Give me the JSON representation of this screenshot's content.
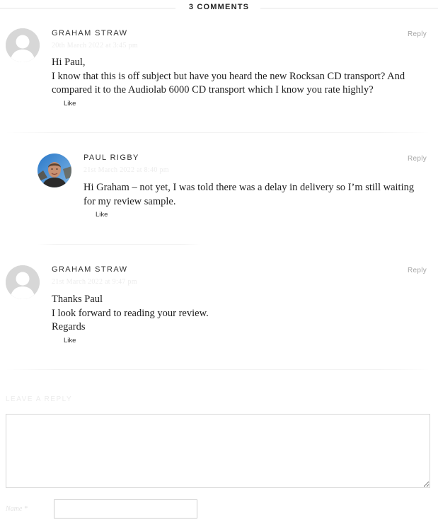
{
  "comments_header": {
    "title": "3 COMMENTS"
  },
  "comments": [
    {
      "author": "GRAHAM STRAW",
      "date": "20th March 2022 at 3:45 pm",
      "reply": "Reply",
      "paragraphs": [
        "Hi Paul,",
        "I know that this is off subject but have you heard the new Rocksan CD transport? And compared it to the Audiolab 6000 CD transport which I know you rate highly?"
      ],
      "like": "Like"
    },
    {
      "author": "PAUL RIGBY",
      "date": "21st March 2022 at 8:40 pm",
      "reply": "Reply",
      "paragraphs": [
        "Hi Graham – not yet, I was told there was a delay in delivery so I’m still waiting for my review sample."
      ],
      "like": "Like"
    },
    {
      "author": "GRAHAM STRAW",
      "date": "21st March 2022 at 9:47 pm",
      "reply": "Reply",
      "paragraphs": [
        "Thanks Paul",
        "I look forward to reading your review.",
        "Regards"
      ],
      "like": "Like"
    }
  ],
  "reply_form": {
    "title": "LEAVE A REPLY",
    "comment_value": "",
    "name_label": "Name *",
    "name_value": ""
  },
  "colors": {
    "accent_text": "#222222",
    "reply_link": "#a6a6a6",
    "avatar_placeholder": "#d7d7d7"
  },
  "icons": {
    "default_avatar": "person-silhouette-icon",
    "photo_avatar": "user-photo-avatar"
  }
}
